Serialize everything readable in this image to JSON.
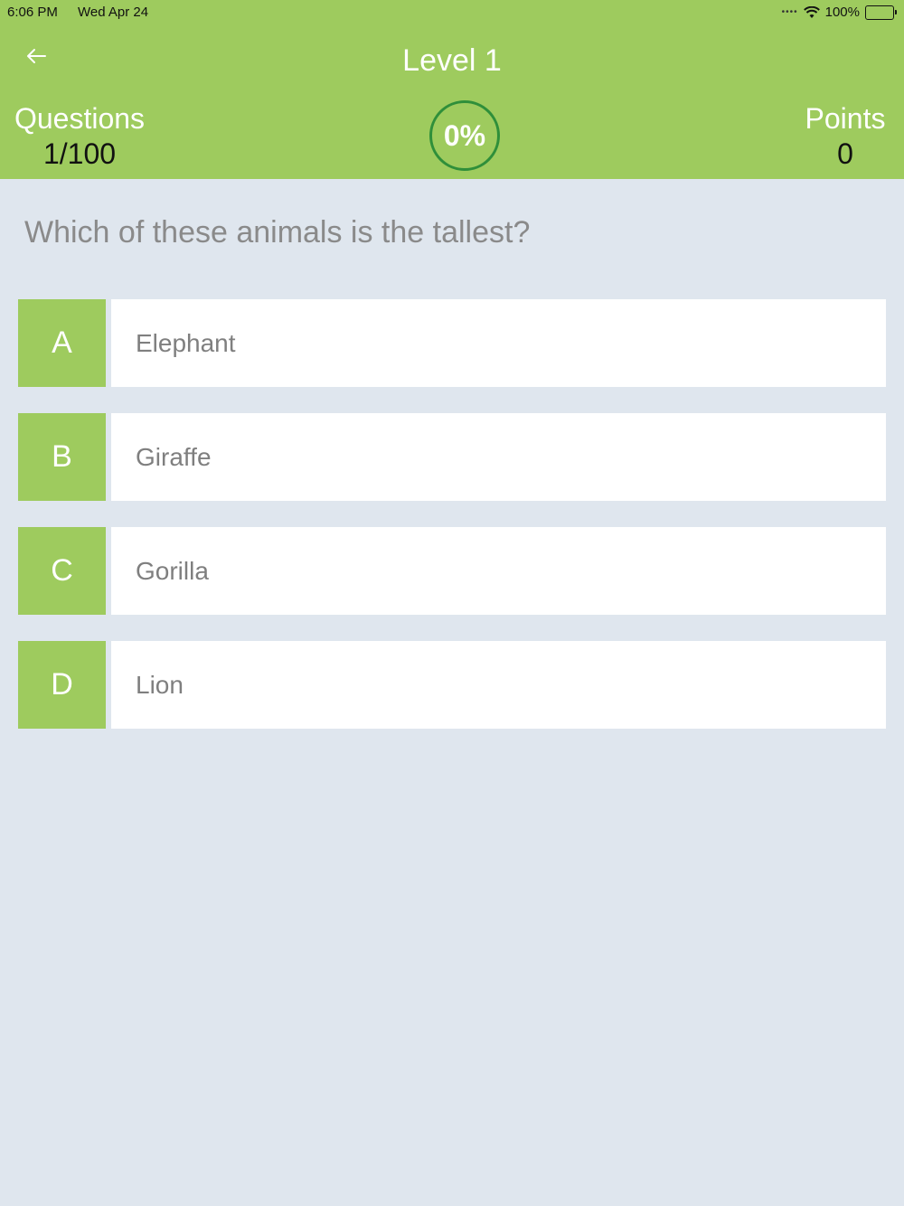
{
  "status_bar": {
    "time": "6:06 PM",
    "date": "Wed Apr 24",
    "signal_icon": "signal-dots-icon",
    "wifi_icon": "wifi-icon",
    "battery_percent": "100%",
    "battery_icon": "battery-icon"
  },
  "header": {
    "back_icon": "arrow-left-icon",
    "title": "Level 1",
    "questions_label": "Questions",
    "questions_value": "1/100",
    "progress": "0%",
    "points_label": "Points",
    "points_value": "0"
  },
  "question": {
    "text": "Which of these animals is the tallest?"
  },
  "options": [
    {
      "letter": "A",
      "text": "Elephant"
    },
    {
      "letter": "B",
      "text": "Giraffe"
    },
    {
      "letter": "C",
      "text": "Gorilla"
    },
    {
      "letter": "D",
      "text": "Lion"
    }
  ],
  "colors": {
    "header_bg": "#9ecb5e",
    "page_bg": "#dfe6ee",
    "progress_ring": "#2f8f3a",
    "option_text": "#7f7f7f",
    "question_text": "#8a8a8a"
  }
}
